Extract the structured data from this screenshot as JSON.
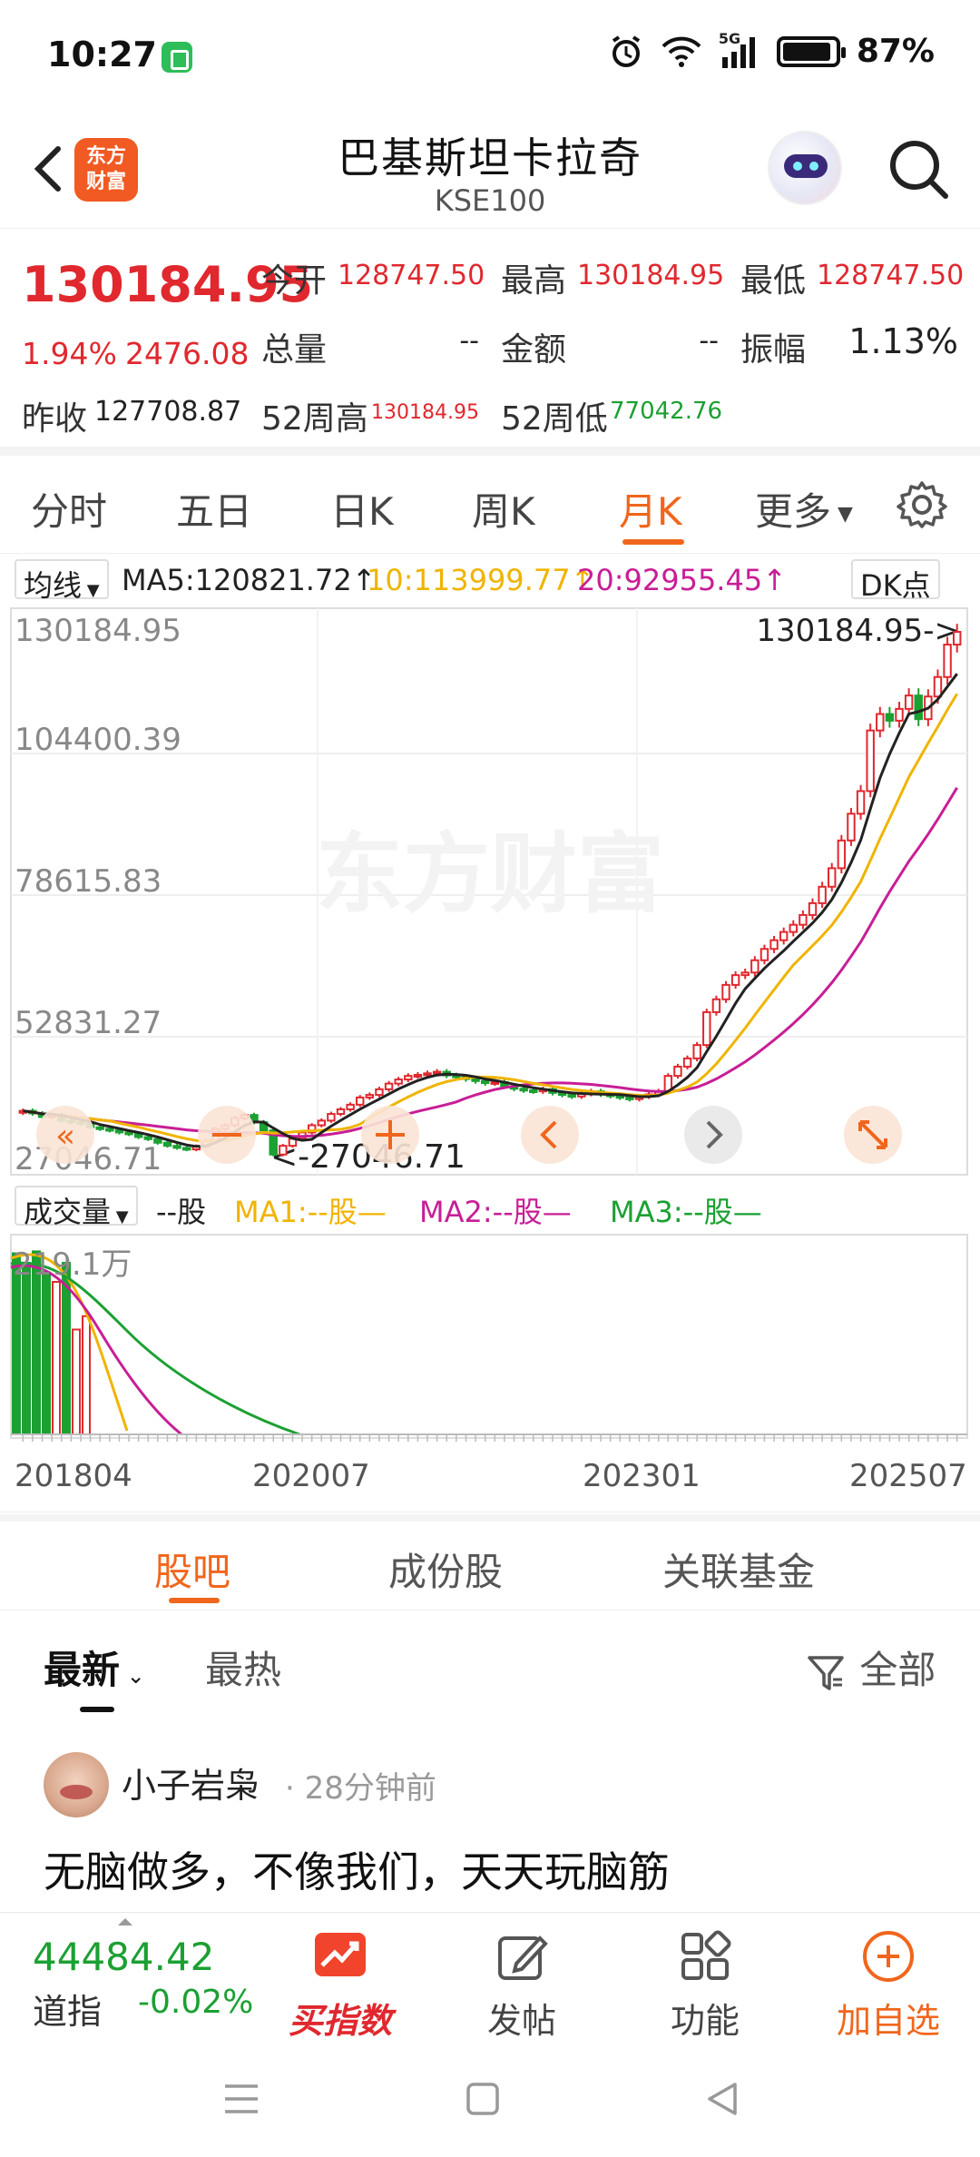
{
  "status": {
    "time": "10:27",
    "network": "5G",
    "battery": "87%"
  },
  "header": {
    "logo_line1": "东方",
    "logo_line2": "财富",
    "title": "巴基斯坦卡拉奇",
    "subtitle": "KSE100"
  },
  "quote": {
    "price": "130184.95",
    "change_pct": "1.94%",
    "change": "2476.08",
    "open_label": "今开",
    "open": "128747.50",
    "high_label": "最高",
    "high": "130184.95",
    "low_label": "最低",
    "low": "128747.50",
    "volume_label": "总量",
    "volume": "--",
    "amount_label": "金额",
    "amount": "--",
    "amplitude_label": "振幅",
    "amplitude": "1.13%",
    "prev_close_label": "昨收",
    "prev_close": "127708.87",
    "w52_high_label": "52周高",
    "w52_high": "130184.95",
    "w52_low_label": "52周低",
    "w52_low": "77042.76"
  },
  "tabs": [
    "分时",
    "五日",
    "日K",
    "周K",
    "月K",
    "更多"
  ],
  "active_tab": "月K",
  "ma_bar": {
    "selector": "均线",
    "ma5": "MA5:120821.72",
    "ma10": "10:113999.77",
    "ma20": "20:92955.45",
    "dk_button": "DK点",
    "ma5_color": "#222222",
    "ma10_color": "#f0b400",
    "ma20_color": "#c81e96"
  },
  "chart_data": {
    "type": "candlestick",
    "y_ticks": [
      "130184.95",
      "104400.39",
      "78615.83",
      "52831.27",
      "27046.71"
    ],
    "ylim": [
      27046.71,
      130184.95
    ],
    "max_label": "130184.95->",
    "min_label": "<-27046.71",
    "x_labels": [
      "201804",
      "202007",
      "202301",
      "202507"
    ],
    "watermark": "东方财富",
    "candles_close": [
      37000,
      36500,
      35800,
      36200,
      35100,
      34800,
      34500,
      33800,
      33500,
      33200,
      32800,
      32500,
      31900,
      31500,
      30800,
      30200,
      29800,
      29500,
      30100,
      31200,
      33500,
      34200,
      35600,
      36200,
      34800,
      33200,
      28500,
      30200,
      31600,
      32800,
      34200,
      35100,
      36400,
      37300,
      38200,
      39600,
      40100,
      41200,
      42300,
      43100,
      43800,
      44000,
      44300,
      44600,
      43900,
      43600,
      43200,
      42800,
      42400,
      42600,
      41800,
      41300,
      41000,
      40800,
      41200,
      40500,
      40100,
      39800,
      40300,
      40800,
      40200,
      39900,
      39600,
      39300,
      39800,
      40200,
      40800,
      43800,
      45600,
      47200,
      49800,
      56200,
      58700,
      61500,
      63400,
      63900,
      66300,
      68500,
      70200,
      71800,
      73200,
      75100,
      77400,
      80600,
      84200,
      89600,
      94800,
      99200,
      111000,
      114200,
      112900,
      115200,
      117800,
      113200,
      117600,
      121400,
      127700,
      130185
    ],
    "volume_y_label": "219.1万",
    "vol_label": "成交量",
    "vol_unit": "--股",
    "vol_ma1": "MA1:--股—",
    "vol_ma2": "MA2:--股—",
    "vol_ma3": "MA3:--股—"
  },
  "community": {
    "tabs": [
      "股吧",
      "成份股",
      "关联基金"
    ],
    "filters": [
      "最新",
      "最热"
    ],
    "filter_all": "全部",
    "post": {
      "author": "小子岩枭",
      "time": "· 28分钟前",
      "text": "无脑做多，不像我们，天天玩脑筋"
    }
  },
  "bottom": {
    "index_value": "44484.42",
    "index_name": "道指",
    "index_pct": "-0.02%",
    "buy_index": "买指数",
    "post": "发帖",
    "functions": "功能",
    "add_watch": "加自选"
  }
}
